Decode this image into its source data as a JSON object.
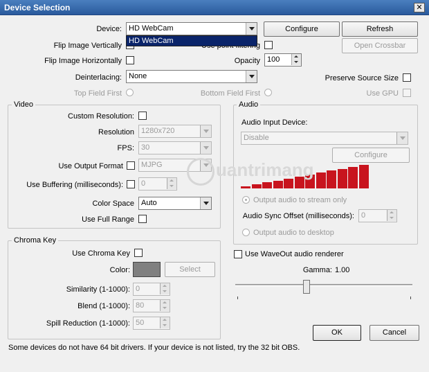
{
  "window": {
    "title": "Device Selection",
    "close_glyph": "✕"
  },
  "device": {
    "label": "Device:",
    "value": "HD WebCam",
    "options": [
      "HD WebCam"
    ],
    "configure": "Configure",
    "refresh": "Refresh",
    "open_crossbar": "Open Crossbar"
  },
  "flip_vertical": {
    "label": "Flip Image Vertically",
    "checked": false
  },
  "use_point_filtering": {
    "label": "Use point filtering",
    "checked": false
  },
  "flip_horizontal": {
    "label": "Flip Image Horizontally",
    "checked": false
  },
  "opacity": {
    "label": "Opacity",
    "value": "100"
  },
  "deinterlacing": {
    "label": "Deinterlacing:",
    "value": "None"
  },
  "preserve_source_size": {
    "label": "Preserve Source Size",
    "checked": false
  },
  "top_field_first": {
    "label": "Top Field First"
  },
  "bottom_field_first": {
    "label": "Bottom Field First"
  },
  "use_gpu": {
    "label": "Use GPU"
  },
  "video": {
    "title": "Video",
    "custom_resolution": {
      "label": "Custom Resolution:",
      "checked": false
    },
    "resolution": {
      "label": "Resolution",
      "value": "1280x720"
    },
    "fps": {
      "label": "FPS:",
      "value": "30"
    },
    "use_output_format": {
      "label": "Use Output Format",
      "value": "MJPG"
    },
    "use_buffering": {
      "label": "Use Buffering (milliseconds):",
      "value": "0"
    },
    "color_space": {
      "label": "Color Space",
      "value": "Auto"
    },
    "use_full_range": {
      "label": "Use Full Range",
      "checked": false
    }
  },
  "audio": {
    "title": "Audio",
    "input_device_label": "Audio Input Device:",
    "input_device_value": "Disable",
    "configure": "Configure",
    "output_to_stream": "Output audio to stream only",
    "sync_offset_label": "Audio Sync Offset (milliseconds):",
    "sync_offset_value": "0",
    "output_to_desktop": "Output audio to desktop",
    "meter_levels": [
      0.1,
      0.17,
      0.25,
      0.33,
      0.42,
      0.5,
      0.58,
      0.67,
      0.75,
      0.83,
      0.92,
      1.0
    ],
    "meter_color": "#c8141e"
  },
  "chroma": {
    "title": "Chroma Key",
    "use_chroma_key": {
      "label": "Use Chroma Key",
      "checked": false
    },
    "color_label": "Color:",
    "color_value": "#808080",
    "select": "Select",
    "similarity": {
      "label": "Similarity (1-1000):",
      "value": "0"
    },
    "blend": {
      "label": "Blend (1-1000):",
      "value": "80"
    },
    "spill": {
      "label": "Spill Reduction (1-1000):",
      "value": "50"
    }
  },
  "waveout": {
    "label": "Use WaveOut audio renderer",
    "checked": false
  },
  "gamma": {
    "label": "Gamma:",
    "value": "1.00"
  },
  "footer_note": "Some devices do not have 64 bit drivers. If your device is not listed, try the 32 bit OBS.",
  "ok": "OK",
  "cancel": "Cancel",
  "watermark": "uantrimang"
}
